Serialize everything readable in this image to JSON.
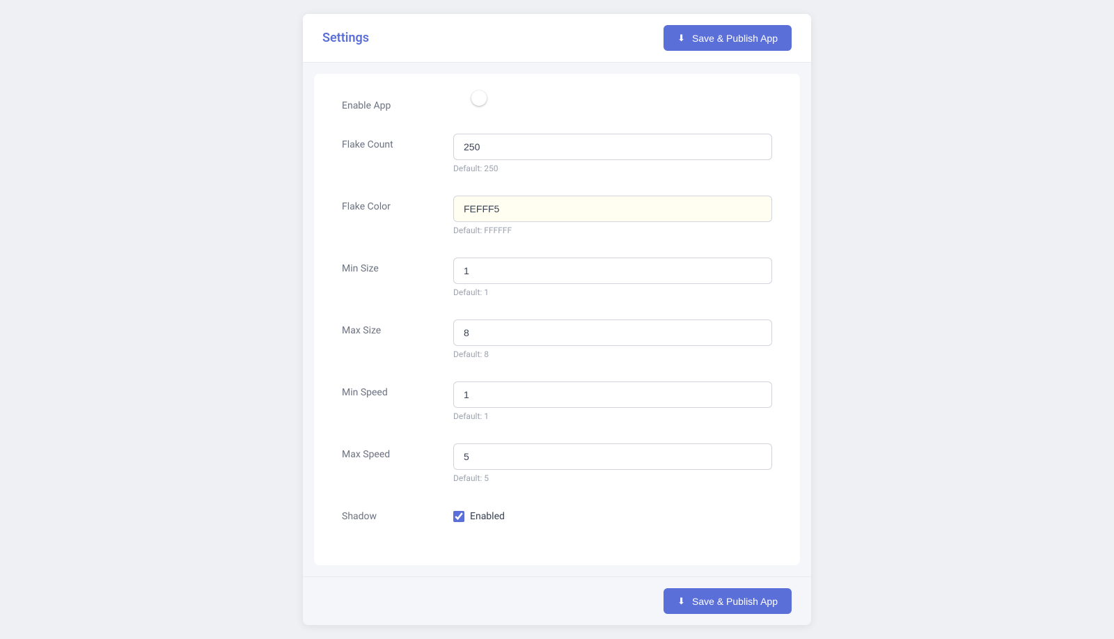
{
  "header": {
    "title": "Settings",
    "save_button_label": "Save & Publish App"
  },
  "footer": {
    "save_button_label": "Save & Publish App"
  },
  "fields": {
    "enable_app": {
      "label": "Enable App",
      "value": true
    },
    "flake_count": {
      "label": "Flake Count",
      "value": "250",
      "default_hint": "Default: 250"
    },
    "flake_color": {
      "label": "Flake Color",
      "value": "FEFFF5",
      "default_hint": "Default: FFFFFF"
    },
    "min_size": {
      "label": "Min Size",
      "value": "1",
      "default_hint": "Default: 1"
    },
    "max_size": {
      "label": "Max Size",
      "value": "8",
      "default_hint": "Default: 8"
    },
    "min_speed": {
      "label": "Min Speed",
      "value": "1",
      "default_hint": "Default: 1"
    },
    "max_speed": {
      "label": "Max Speed",
      "value": "5",
      "default_hint": "Default: 5"
    },
    "shadow": {
      "label": "Shadow",
      "checkbox_label": "Enabled",
      "checked": true
    }
  },
  "colors": {
    "primary": "#5b6fd8",
    "toggle_on": "#2196F3"
  }
}
